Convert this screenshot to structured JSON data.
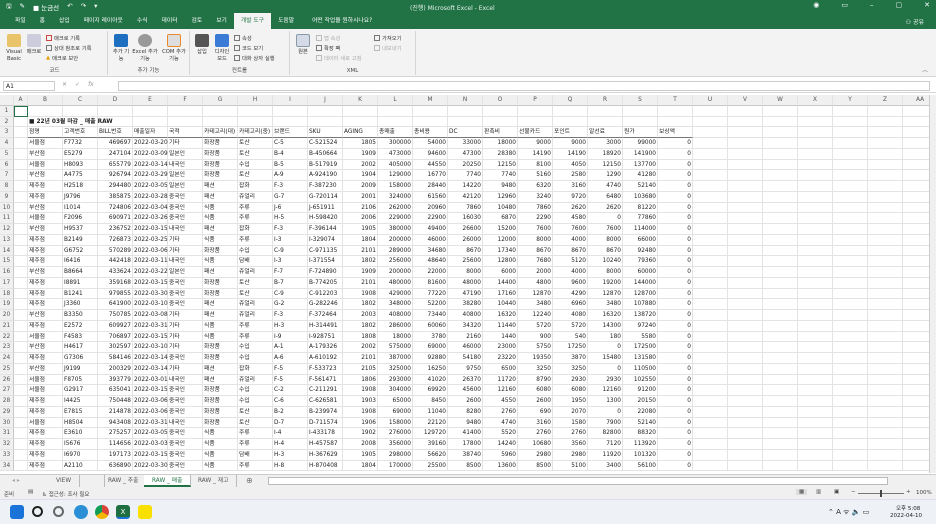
{
  "titlebar": {
    "autosave": "눈금선",
    "title": "(진행) Microsoft Excel  -  Excel",
    "share": "공유"
  },
  "tabs": [
    "파일",
    "홈",
    "삽입",
    "페이지 레이아웃",
    "수식",
    "데이터",
    "검토",
    "보기",
    "개발 도구",
    "도움말",
    "어떤 작업을 원하시나요?"
  ],
  "active_tab": 8,
  "ribbon": {
    "code": {
      "label": "코드",
      "visual_basic": "Visual Basic",
      "macro": "매크로",
      "record": "매크로 기록",
      "relative": "상대 참조로 기록",
      "security": "매크로 보안"
    },
    "addins": {
      "label": "추가 기능",
      "addins": "추가 기능",
      "excel_addins": "Excel 추가 기능",
      "com_addins": "COM 추가 기능"
    },
    "controls": {
      "label": "컨트롤",
      "insert": "삽입",
      "design": "디자인 모드",
      "properties": "속성",
      "view_code": "코드 보기",
      "run_dialog": "대화 상자 실행"
    },
    "xml": {
      "label": "XML",
      "source": "원본",
      "map_props": "맵 속성",
      "expansion": "확장 팩",
      "refresh": "데이터 새로 고침",
      "import": "가져오기",
      "export": "내보내기"
    }
  },
  "formula_bar": {
    "name_box": "A1",
    "value": ""
  },
  "columns": [
    "A",
    "B",
    "C",
    "D",
    "E",
    "F",
    "G",
    "H",
    "I",
    "J",
    "K",
    "L",
    "M",
    "N",
    "O",
    "P",
    "Q",
    "R",
    "S",
    "T",
    "U",
    "V",
    "W",
    "X",
    "Y",
    "Z",
    "AA"
  ],
  "sheet_title": "■ 22년 03월 마감 _ 매출 RAW",
  "headers": [
    "점명",
    "고객번호",
    "BILL번호",
    "매출일자",
    "국적",
    "카테고리(대)",
    "카테고리(중)",
    "브랜드",
    "SKU",
    "AGING",
    "총매출",
    "총비용",
    "DC",
    "판촉비",
    "선불카드",
    "포인트",
    "알선료",
    "원가",
    "보상액"
  ],
  "rows": [
    [
      "서울점",
      "F7732",
      469697,
      "2022-03-20",
      "기타",
      "화장품",
      "토산",
      "C-5",
      "C-521524",
      1805,
      300000,
      54000,
      33000,
      18000,
      9000,
      9000,
      3000,
      99000,
      0
    ],
    [
      "부산점",
      "E5279",
      247104,
      "2022-03-09",
      "일본인",
      "화장품",
      "토산",
      "B-4",
      "B-450664",
      1909,
      473000,
      94600,
      47300,
      28380,
      14190,
      14190,
      18920,
      141900,
      0
    ],
    [
      "서울점",
      "H8093",
      655779,
      "2022-03-14",
      "내국인",
      "화장품",
      "수입",
      "B-5",
      "B-517919",
      2002,
      405000,
      44550,
      20250,
      12150,
      8100,
      4050,
      12150,
      137700,
      0
    ],
    [
      "부산점",
      "A4775",
      926794,
      "2022-03-29",
      "일본인",
      "화장품",
      "토산",
      "A-9",
      "A-924190",
      1904,
      129000,
      16770,
      7740,
      7740,
      5160,
      2580,
      1290,
      41280,
      0
    ],
    [
      "제주점",
      "H2518",
      294480,
      "2022-03-05",
      "일본인",
      "패션",
      "잡화",
      "F-3",
      "F-387230",
      2009,
      158000,
      28440,
      14220,
      9480,
      6320,
      3160,
      4740,
      52140,
      0
    ],
    [
      "제주점",
      "J9796",
      385875,
      "2022-03-28",
      "중국인",
      "패션",
      "쥬얼리",
      "G-7",
      "G-720114",
      2001,
      324000,
      61560,
      42120,
      12960,
      3240,
      9720,
      6480,
      103680,
      0
    ],
    [
      "부산점",
      "I1014",
      724806,
      "2022-03-04",
      "중국인",
      "식품",
      "주류",
      "J-6",
      "J-651911",
      2106,
      262000,
      20960,
      7860,
      10480,
      7860,
      2620,
      2620,
      81220,
      0
    ],
    [
      "서울점",
      "F2096",
      690971,
      "2022-03-26",
      "중국인",
      "식품",
      "주류",
      "H-5",
      "H-598420",
      2006,
      229000,
      22900,
      16030,
      6870,
      2290,
      4580,
      0,
      77860,
      0
    ],
    [
      "부산점",
      "H9537",
      236752,
      "2022-03-15",
      "내국인",
      "패션",
      "잡화",
      "F-3",
      "F-396144",
      1905,
      380000,
      49400,
      26600,
      15200,
      7600,
      7600,
      7600,
      114000,
      0
    ],
    [
      "제주점",
      "B2149",
      726873,
      "2022-03-25",
      "기타",
      "식품",
      "주류",
      "I-3",
      "I-329074",
      1804,
      200000,
      46000,
      26000,
      12000,
      8000,
      4000,
      8000,
      66000,
      0
    ],
    [
      "제주점",
      "G6752",
      570289,
      "2022-03-06",
      "기타",
      "화장품",
      "수입",
      "C-9",
      "C-971135",
      2101,
      289000,
      34680,
      8670,
      17340,
      8670,
      8670,
      8670,
      92480,
      0
    ],
    [
      "제주점",
      "I6416",
      442418,
      "2022-03-11",
      "내국인",
      "식품",
      "담배",
      "I-3",
      "I-371554",
      1802,
      256000,
      48640,
      25600,
      12800,
      7680,
      5120,
      10240,
      79360,
      0
    ],
    [
      "부산점",
      "B8664",
      433624,
      "2022-03-22",
      "일본인",
      "패션",
      "쥬얼리",
      "F-7",
      "F-724890",
      1909,
      200000,
      22000,
      8000,
      6000,
      2000,
      4000,
      8000,
      60000,
      0
    ],
    [
      "제주점",
      "I8891",
      359168,
      "2022-03-15",
      "중국인",
      "화장품",
      "토산",
      "B-7",
      "B-774205",
      2101,
      480000,
      81600,
      48000,
      14400,
      4800,
      9600,
      19200,
      144000,
      0
    ],
    [
      "제주점",
      "B1241",
      979855,
      "2022-03-30",
      "중국인",
      "화장품",
      "토산",
      "C-9",
      "C-912203",
      1908,
      429000,
      77220,
      47190,
      17160,
      12870,
      4290,
      12870,
      128700,
      0
    ],
    [
      "제주점",
      "J3360",
      641900,
      "2022-03-10",
      "중국인",
      "패션",
      "쥬얼리",
      "G-2",
      "G-282246",
      1802,
      348000,
      52200,
      38280,
      10440,
      3480,
      6960,
      3480,
      107880,
      0
    ],
    [
      "부산점",
      "B3350",
      750785,
      "2022-03-08",
      "기타",
      "패션",
      "쥬얼리",
      "F-3",
      "F-372464",
      2003,
      408000,
      73440,
      40800,
      16320,
      12240,
      4080,
      16320,
      138720,
      0
    ],
    [
      "제주점",
      "E2572",
      609927,
      "2022-03-31",
      "기타",
      "식품",
      "주류",
      "H-3",
      "H-314491",
      1802,
      286000,
      60060,
      34320,
      11440,
      5720,
      5720,
      14300,
      97240,
      0
    ],
    [
      "서울점",
      "F4583",
      706897,
      "2022-03-15",
      "기타",
      "식품",
      "주류",
      "I-9",
      "I-928751",
      1808,
      18000,
      3780,
      2160,
      1440,
      900,
      540,
      180,
      5580,
      0
    ],
    [
      "부산점",
      "H4617",
      302597,
      "2022-03-10",
      "기타",
      "화장품",
      "수입",
      "A-1",
      "A-179326",
      2002,
      575000,
      69000,
      46000,
      23000,
      5750,
      17250,
      0,
      172500,
      0
    ],
    [
      "제주점",
      "G7306",
      584146,
      "2022-03-14",
      "중국인",
      "화장품",
      "수입",
      "A-6",
      "A-610192",
      2101,
      387000,
      92880,
      54180,
      23220,
      19350,
      3870,
      15480,
      131580,
      0
    ],
    [
      "부산점",
      "J9199",
      200329,
      "2022-03-14",
      "기타",
      "패션",
      "잡화",
      "F-5",
      "F-533723",
      2105,
      325000,
      16250,
      9750,
      6500,
      3250,
      3250,
      0,
      110500,
      0
    ],
    [
      "서울점",
      "F8705",
      393779,
      "2022-03-01",
      "내국인",
      "패션",
      "쥬얼리",
      "F-5",
      "F-561471",
      1806,
      293000,
      41020,
      26370,
      11720,
      8790,
      2930,
      2930,
      102550,
      0
    ],
    [
      "서울점",
      "G2917",
      635041,
      "2022-03-15",
      "중국인",
      "화장품",
      "수입",
      "C-2",
      "C-211291",
      1908,
      304000,
      69920,
      45600,
      12160,
      6080,
      6080,
      12160,
      91200,
      0
    ],
    [
      "제주점",
      "I4425",
      750448,
      "2022-03-06",
      "중국인",
      "화장품",
      "수입",
      "C-6",
      "C-626581",
      1903,
      65000,
      8450,
      2600,
      4550,
      2600,
      1950,
      1300,
      20150,
      0
    ],
    [
      "제주점",
      "E7815",
      214878,
      "2022-03-06",
      "중국인",
      "화장품",
      "토산",
      "B-2",
      "B-239974",
      1908,
      69000,
      11040,
      8280,
      2760,
      690,
      2070,
      0,
      22080,
      0
    ],
    [
      "서울점",
      "H8504",
      943408,
      "2022-03-31",
      "내국인",
      "화장품",
      "토산",
      "D-7",
      "D-711574",
      1906,
      158000,
      22120,
      9480,
      4740,
      3160,
      1580,
      7900,
      52140,
      0
    ],
    [
      "제주점",
      "E3610",
      275257,
      "2022-03-05",
      "중국인",
      "식품",
      "주류",
      "I-4",
      "I-433178",
      1902,
      276000,
      129720,
      41400,
      5520,
      2760,
      2760,
      82800,
      88320,
      0
    ],
    [
      "제주점",
      "I5676",
      114656,
      "2022-03-03",
      "중국인",
      "식품",
      "주류",
      "H-4",
      "H-457587",
      2008,
      356000,
      39160,
      17800,
      14240,
      10680,
      3560,
      7120,
      113920,
      0
    ],
    [
      "제주점",
      "I6970",
      197173,
      "2022-03-15",
      "중국인",
      "식품",
      "담배",
      "H-3",
      "H-367629",
      1905,
      298000,
      56620,
      38740,
      5960,
      2980,
      2980,
      11920,
      101320,
      0
    ],
    [
      "제주점",
      "A2110",
      636890,
      "2022-03-30",
      "중국인",
      "식품",
      "주류",
      "H-8",
      "H-870408",
      1804,
      170000,
      25500,
      8500,
      13600,
      8500,
      5100,
      3400,
      56100,
      0
    ]
  ],
  "sheet_tabs": [
    "VIEW",
    "",
    "RAW _ 추출",
    "RAW _ 매출",
    "RAW _ 재고"
  ],
  "active_sheet": 3,
  "status": {
    "ready": "준비",
    "accessibility": "접근성: 조사 필요",
    "zoom": "100%"
  },
  "taskbar": {
    "time": "오후 5:08",
    "date": "2022-04-10"
  },
  "colors": {
    "excel_green": "#217346"
  }
}
